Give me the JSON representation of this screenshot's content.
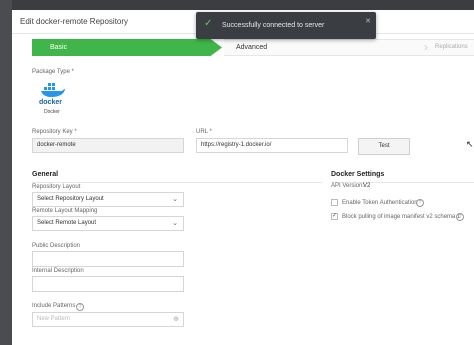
{
  "window": {
    "title": "Edit docker-remote Repository"
  },
  "steps": {
    "basic": "Basic",
    "advanced": "Advanced",
    "replications": "Replications"
  },
  "package_type": {
    "label": "Package Type *",
    "logo_text": "docker",
    "name": "Docker"
  },
  "repository_key": {
    "label": "Repository Key *",
    "value": "docker-remote"
  },
  "url": {
    "label": "URL *",
    "value": "https://registry-1.docker.io/"
  },
  "test_button": "Test",
  "general": {
    "title": "General",
    "repository_layout_label": "Repository Layout",
    "repository_layout_value": "Select Repository Layout",
    "remote_layout_label": "Remote Layout Mapping",
    "remote_layout_value": "Select Remote Layout",
    "public_description_label": "Public Description",
    "internal_description_label": "Internal Description",
    "include_patterns_label": "Include Patterns",
    "include_patterns_placeholder": "New Pattern"
  },
  "docker_settings": {
    "title": "Docker Settings",
    "api_version": "API Version:",
    "api_version_value": "V2",
    "enable_token_auth": "Enable Token Authentication",
    "enable_token_auth_checked": false,
    "block_pulling": "Block pulling of image manifest v2 schema 1",
    "block_pulling_checked": true
  },
  "toast": {
    "message": "Successfully connected to server"
  },
  "colors": {
    "accent_green": "#40b549",
    "docker_blue": "#2496ed",
    "toast_bg": "#3a3d42"
  },
  "icons": {
    "toast": "check-icon",
    "close": "close-icon",
    "help": "question-circle-icon",
    "caret": "chevron-down-icon",
    "cursor": "mouse-pointer-icon"
  }
}
